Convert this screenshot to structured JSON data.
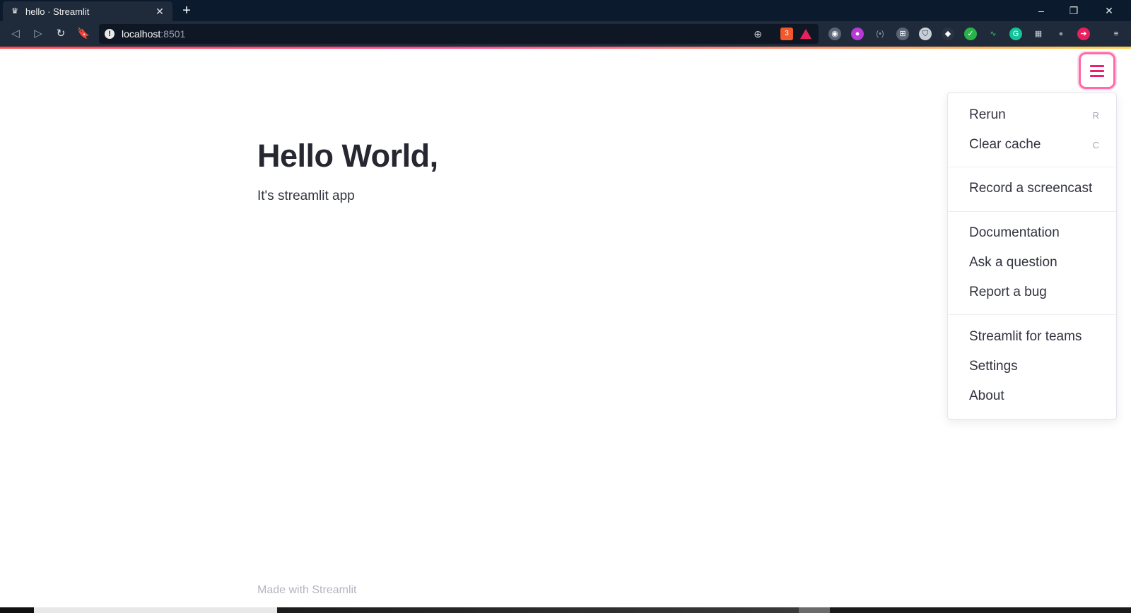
{
  "browser": {
    "tab_title": "hello · Streamlit",
    "tab_close": "✕",
    "new_tab": "+",
    "url_host": "localhost",
    "url_port": ":8501",
    "brave_badge": "3",
    "window_controls": [
      "–",
      "❐",
      "✕"
    ]
  },
  "app": {
    "heading": "Hello World,",
    "subtext": "It's streamlit app",
    "footer": "Made with Streamlit"
  },
  "menu": {
    "accent_color": "#e8206d",
    "items": [
      {
        "label": "Rerun",
        "shortcut": "R"
      },
      {
        "label": "Clear cache",
        "shortcut": "C"
      },
      {
        "label": "Record a screencast"
      },
      {
        "label": "Documentation"
      },
      {
        "label": "Ask a question"
      },
      {
        "label": "Report a bug"
      },
      {
        "label": "Streamlit for teams"
      },
      {
        "label": "Settings"
      },
      {
        "label": "About"
      }
    ]
  },
  "icons": {
    "favicon": "streamlit-crown-icon",
    "info": "info-icon",
    "zoom": "zoom-icon",
    "hamburger": "hamburger-menu-icon"
  }
}
